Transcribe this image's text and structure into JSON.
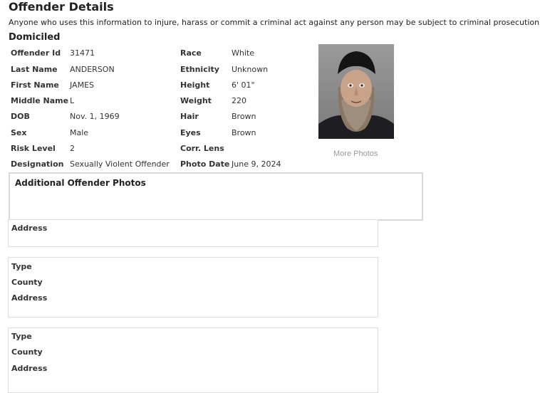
{
  "page": {
    "title": "Offender Details",
    "warning": "Anyone who uses this information to injure, harass or commit a criminal act against any person may be subject to criminal prosecution.",
    "status": "Domiciled"
  },
  "details": {
    "left": [
      {
        "label": "Offender Id",
        "value": "31471"
      },
      {
        "label": "Last Name",
        "value": "ANDERSON"
      },
      {
        "label": "First Name",
        "value": "JAMES"
      },
      {
        "label": "Middle Name",
        "value": "L"
      },
      {
        "label": "DOB",
        "value": "Nov. 1, 1969"
      },
      {
        "label": "Sex",
        "value": "Male"
      },
      {
        "label": "Risk Level",
        "value": "2"
      },
      {
        "label": "Designation",
        "value": "Sexually Violent Offender"
      }
    ],
    "right": [
      {
        "label": "Race",
        "value": "White"
      },
      {
        "label": "Ethnicity",
        "value": "Unknown"
      },
      {
        "label": "Height",
        "value": "6' 01\""
      },
      {
        "label": "Weight",
        "value": "220"
      },
      {
        "label": "Hair",
        "value": "Brown"
      },
      {
        "label": "Eyes",
        "value": "Brown"
      },
      {
        "label": "Corr. Lens",
        "value": ""
      },
      {
        "label": "Photo Date",
        "value": "June 9, 2024"
      }
    ]
  },
  "photo": {
    "more_photos_label": "More Photos"
  },
  "additional_photos": {
    "title": "Additional Offender Photos"
  },
  "addresses": {
    "first_label": "Address",
    "blocks": [
      {
        "type_label": "Type",
        "county_label": "County",
        "address_label": "Address"
      },
      {
        "type_label": "Type",
        "county_label": "County",
        "address_label": "Address"
      }
    ]
  }
}
